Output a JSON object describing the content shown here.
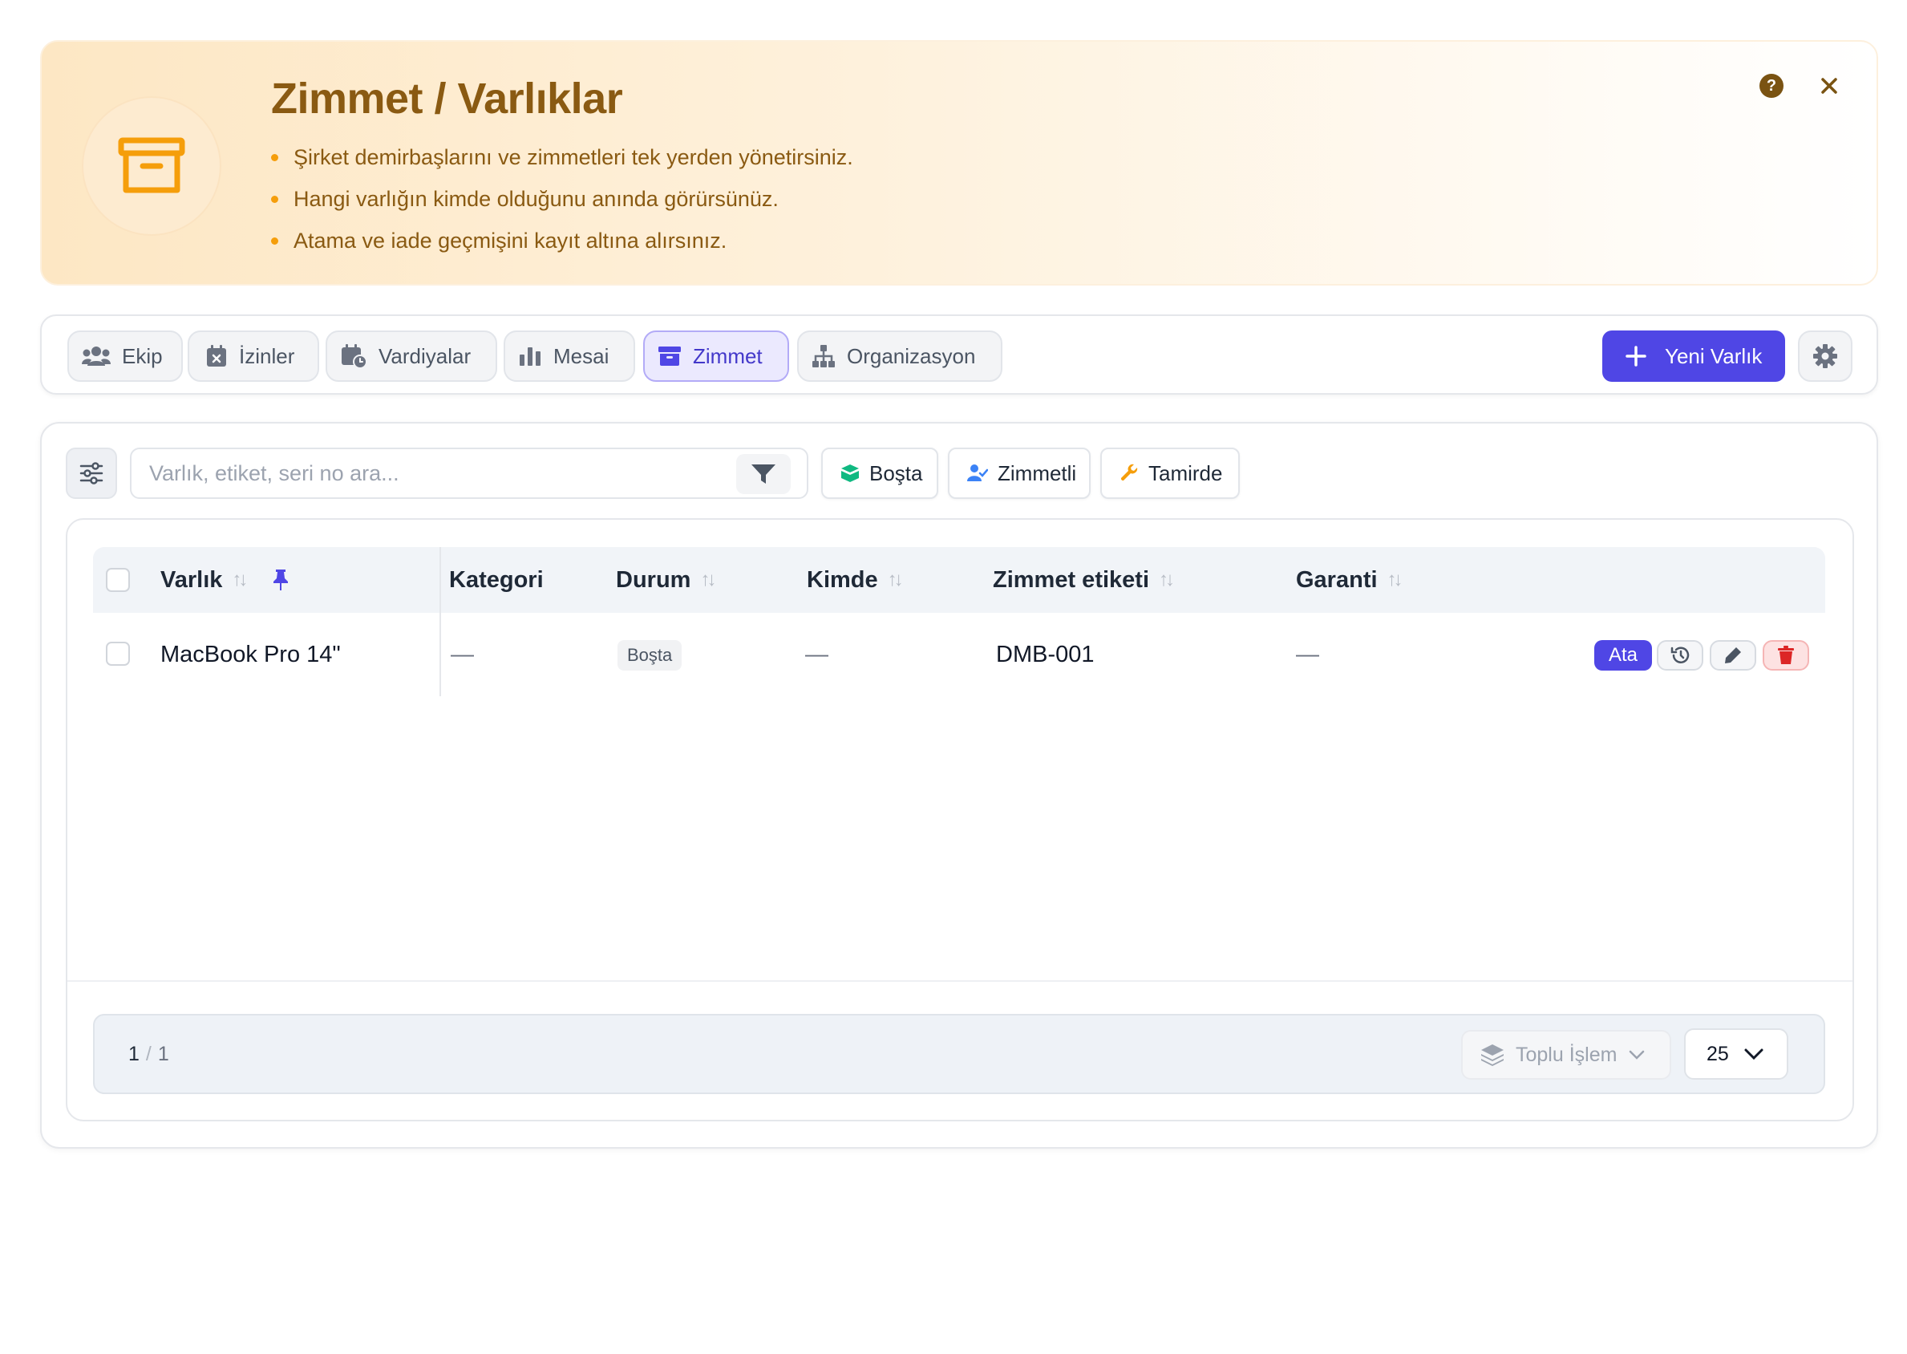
{
  "banner": {
    "title": "Zimmet / Varlıklar",
    "bullets": [
      "Şirket demirbaşlarını ve zimmetleri tek yerden yönetirsiniz.",
      "Hangi varlığın kimde olduğunu anında görürsünüz.",
      "Atama ve iade geçmişini kayıt altına alırsınız."
    ],
    "icon": "archive-box-icon",
    "help_glyph": "?",
    "accent": "#f59e0b",
    "title_color": "#8a5a12"
  },
  "tabs": [
    {
      "label": "Ekip",
      "icon": "users-icon",
      "active": false
    },
    {
      "label": "İzinler",
      "icon": "calendar-x-icon",
      "active": false
    },
    {
      "label": "Vardiyalar",
      "icon": "calendar-clock-icon",
      "active": false
    },
    {
      "label": "Mesai",
      "icon": "bar-chart-icon",
      "active": false
    },
    {
      "label": "Zimmet",
      "icon": "archive-icon",
      "active": true
    },
    {
      "label": "Organizasyon",
      "icon": "org-chart-icon",
      "active": false
    }
  ],
  "toolbar": {
    "new_label": "Yeni Varlık",
    "primary_color": "#4f46e5"
  },
  "search": {
    "placeholder": "Varlık, etiket, seri no ara...",
    "value": ""
  },
  "filters": [
    {
      "label": "Boşta",
      "icon": "box-icon",
      "color": "#10b981"
    },
    {
      "label": "Zimmetli",
      "icon": "user-check-icon",
      "color": "#3b82f6"
    },
    {
      "label": "Tamirde",
      "icon": "wrench-icon",
      "color": "#f59e0b"
    }
  ],
  "table": {
    "columns": [
      "Varlık",
      "Kategori",
      "Durum",
      "Kimde",
      "Zimmet etiketi",
      "Garanti"
    ],
    "rows": [
      {
        "varlik": "MacBook Pro 14\"",
        "kategori": "—",
        "durum": "Boşta",
        "kimde": "—",
        "etiket": "DMB-001",
        "garanti": "—",
        "assign_label": "Ata"
      }
    ]
  },
  "footer": {
    "page_current": "1",
    "page_separator": "/",
    "page_total": "1",
    "bulk_label": "Toplu İşlem",
    "per_page": "25"
  }
}
